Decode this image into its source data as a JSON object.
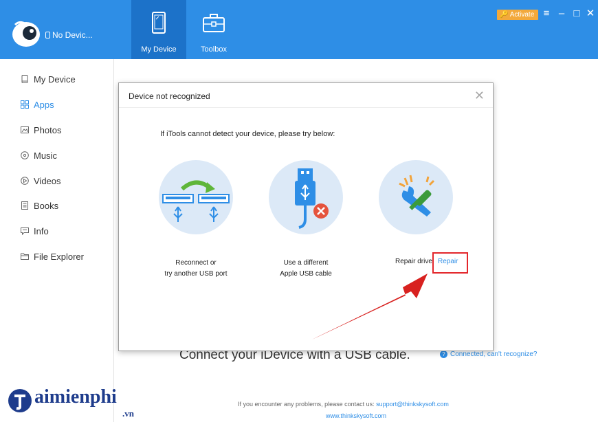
{
  "titlebar": {
    "device_status": "No Devic...",
    "tabs": [
      {
        "label": "My Device",
        "active": true
      },
      {
        "label": "Toolbox",
        "active": false
      }
    ],
    "activate_label": "Activate",
    "controls": [
      "menu",
      "minimize",
      "maximize",
      "close"
    ]
  },
  "sidebar": {
    "items": [
      {
        "label": "My Device",
        "icon": "phone-icon"
      },
      {
        "label": "Apps",
        "icon": "apps-grid-icon",
        "active": true
      },
      {
        "label": "Photos",
        "icon": "photo-icon"
      },
      {
        "label": "Music",
        "icon": "music-icon"
      },
      {
        "label": "Videos",
        "icon": "video-icon"
      },
      {
        "label": "Books",
        "icon": "book-icon"
      },
      {
        "label": "Info",
        "icon": "info-chat-icon"
      },
      {
        "label": "File Explorer",
        "icon": "folder-icon"
      }
    ]
  },
  "dialog": {
    "title": "Device not recognized",
    "instruction": "If iTools cannot detect your device, please try  below:",
    "options": [
      {
        "line1": "Reconnect or",
        "line2": "try another USB port",
        "icon": "usb-reconnect-icon"
      },
      {
        "line1": "Use a different",
        "line2": "Apple USB cable",
        "icon": "usb-cable-error-icon"
      },
      {
        "line1": "Repair drive",
        "icon": "repair-tools-icon"
      }
    ],
    "repair_link": "Repair"
  },
  "main": {
    "connect_message": "Connect your iDevice with a USB cable.",
    "help_link": "Connected, can't recognize?",
    "contact_text": "If you encounter any problems, please contact us:",
    "contact_email": "support@thinkskysoft.com",
    "website": "www.thinkskysoft.com"
  },
  "watermark": {
    "brand": "aimienphi",
    "tld": ".vn"
  },
  "colors": {
    "titlebar": "#2e8ee6",
    "active_tab": "#1c72c9",
    "activate": "#f3a93b",
    "accent": "#2e8ee6",
    "highlight": "#e3262b"
  }
}
